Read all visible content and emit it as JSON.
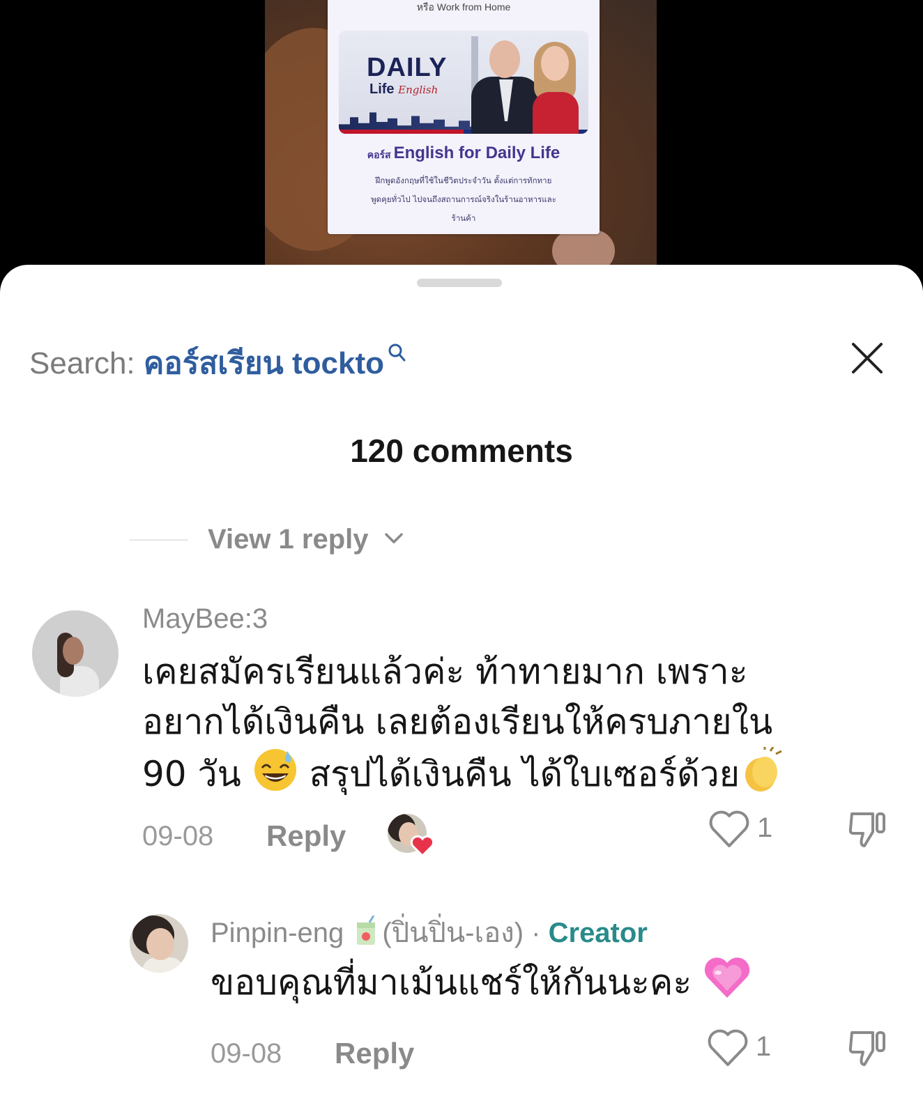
{
  "video": {
    "card_top_text": "หรือ Work from Home",
    "brand_big": "DAILY",
    "brand_small": "Life",
    "brand_script": "English",
    "course_prefix": "คอร์ส",
    "course_title": "English for Daily Life",
    "course_desc_lines": [
      "ฝึกพูดอังกฤษที่ใช้ในชีวิตประจำวัน ตั้งแต่การทักทาย",
      "พูดคุยทั่วไป ไปจนถึงสถานการณ์จริงในร้านอาหารและ",
      "ร้านค้า"
    ]
  },
  "search": {
    "label": "Search: ",
    "term": "คอร์สเรียน tockto"
  },
  "comments_header": "120 comments",
  "view_reply": "View 1 reply",
  "comments": [
    {
      "username": "MayBee:3",
      "text_lines": [
        "เคยสมัครเรียนแล้วค่ะ ท้าทายมาก เพราะ",
        "อยากได้เงินคืน เลยต้องเรียนให้ครบภายใน",
        "90 วัน",
        "สรุปได้เงินคืน ได้ใบเซอร์ด้วย"
      ],
      "emojis": [
        "grinning-sweat-emoji",
        "clapping-hands-emoji"
      ],
      "date": "09-08",
      "reply_label": "Reply",
      "likes": "1",
      "liked_by_creator": true
    },
    {
      "username": "Pinpin-eng",
      "username_suffix": "(ปิ่นปิ่น-เอง)",
      "separator": "·",
      "creator_label": "Creator",
      "text": "ขอบคุณที่มาเม้นแชร์ให้กันนะคะ",
      "emojis": [
        "growing-heart-emoji"
      ],
      "date": "09-08",
      "reply_label": "Reply",
      "likes": "1"
    }
  ],
  "colors": {
    "search_term": "#2f5d9e",
    "creator_tag": "#2a8a8a",
    "muted_text": "#8a8a8a",
    "heart_red": "#e8324a"
  }
}
